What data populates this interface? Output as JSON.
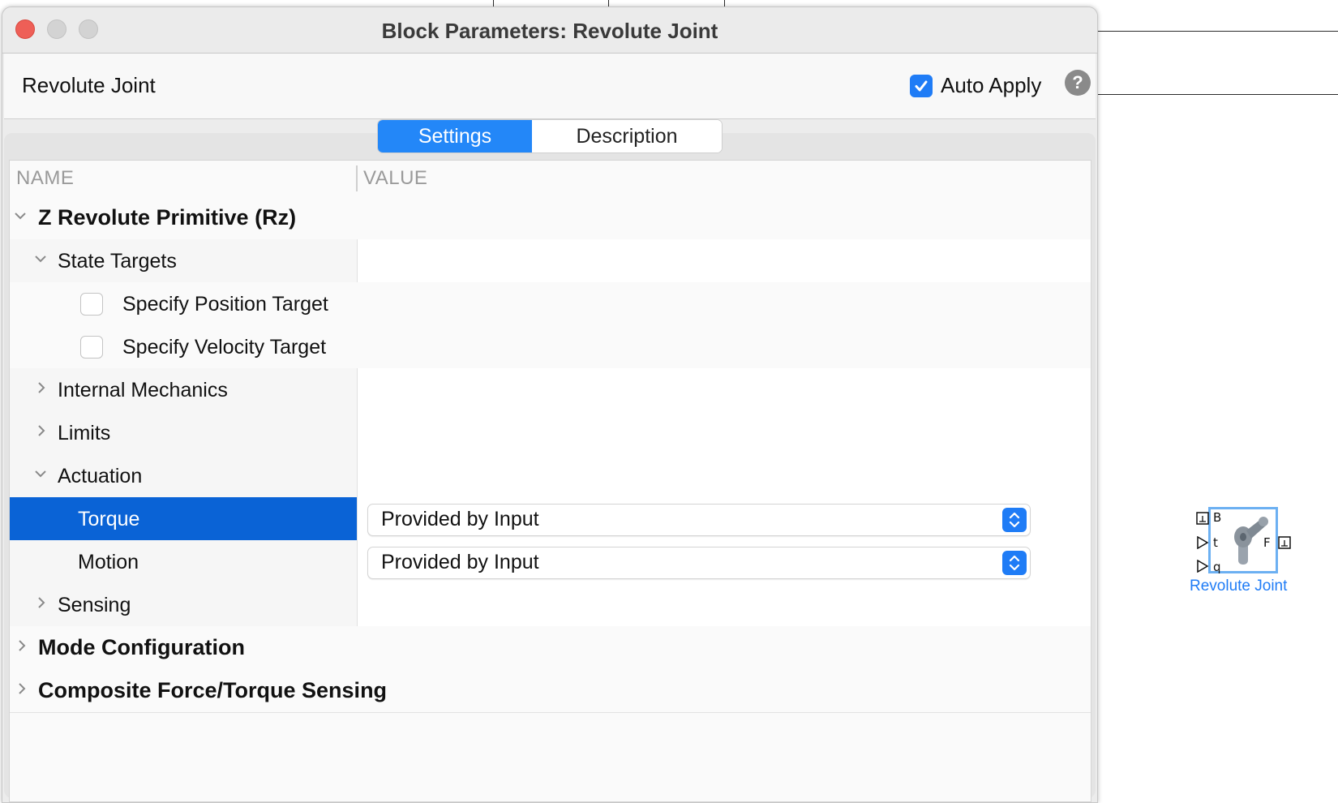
{
  "dialog": {
    "title": "Block Parameters: Revolute Joint",
    "block_name": "Revolute Joint",
    "auto_apply": {
      "label": "Auto Apply",
      "checked": true
    },
    "help_icon": "question-mark-icon",
    "tabs": [
      {
        "label": "Settings",
        "active": true
      },
      {
        "label": "Description",
        "active": false
      }
    ]
  },
  "table": {
    "columns": [
      "NAME",
      "VALUE"
    ],
    "rows": {
      "z_primitive": {
        "label": "Z Revolute Primitive (Rz)",
        "expanded": true
      },
      "state_targets": {
        "label": "State Targets",
        "expanded": true
      },
      "specify_position": {
        "label": "Specify Position Target",
        "checked": false
      },
      "specify_velocity": {
        "label": "Specify Velocity Target",
        "checked": false
      },
      "internal_mechanics": {
        "label": "Internal Mechanics",
        "expanded": false
      },
      "limits": {
        "label": "Limits",
        "expanded": false
      },
      "actuation": {
        "label": "Actuation",
        "expanded": true
      },
      "torque": {
        "label": "Torque",
        "value": "Provided by Input",
        "selected": true
      },
      "motion": {
        "label": "Motion",
        "value": "Provided by Input"
      },
      "sensing": {
        "label": "Sensing",
        "expanded": false
      },
      "mode_configuration": {
        "label": "Mode Configuration",
        "expanded": false
      },
      "composite_sensing": {
        "label": "Composite Force/Torque Sensing",
        "expanded": false
      }
    }
  },
  "canvas_block": {
    "name": "Revolute Joint",
    "ports": {
      "base": "B",
      "torque": "t",
      "position": "q",
      "follower": "F"
    }
  },
  "colors": {
    "accent": "#1f7cf6",
    "selection": "#0a63d6",
    "close_button": "#ee5f57"
  }
}
